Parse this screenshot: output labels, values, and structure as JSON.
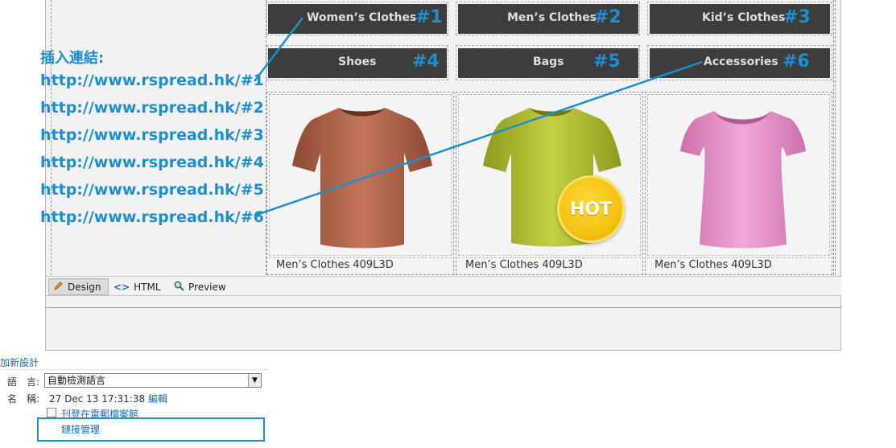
{
  "nav_buttons": [
    {
      "label": "Women’s Clothes",
      "tag": "#1"
    },
    {
      "label": "Men’s Clothes",
      "tag": "#2"
    },
    {
      "label": "Kid’s Clothes",
      "tag": "#3"
    },
    {
      "label": "Shoes",
      "tag": "#4"
    },
    {
      "label": "Bags",
      "tag": "#5"
    },
    {
      "label": "Accessories",
      "tag": "#6"
    }
  ],
  "products": [
    {
      "caption": "Men’s Clothes 409L3D",
      "shirt": "tshirt-brown-image",
      "color": "#b5694f"
    },
    {
      "caption": "Men’s Clothes 409L3D",
      "shirt": "tshirt-lime-image",
      "color": "#b8c33a"
    },
    {
      "caption": "Men’s Clothes 409L3D",
      "shirt": "tshirt-pink-image",
      "color": "#e392c7"
    }
  ],
  "hot_badge": "HOT",
  "annotation": {
    "title": "插入連結:",
    "links": [
      "http://www.rspread.hk/#1",
      "http://www.rspread.hk/#2",
      "http://www.rspread.hk/#3",
      "http://www.rspread.hk/#4",
      "http://www.rspread.hk/#5",
      "http://www.rspread.hk/#6"
    ],
    "color": "#1b8fd2"
  },
  "tabs": [
    {
      "label": "Design",
      "icon": "pencil-icon"
    },
    {
      "label": "HTML",
      "icon": "code-icon"
    },
    {
      "label": "Preview",
      "icon": "magnifier-icon"
    }
  ],
  "settings": {
    "section_link": "加新設計",
    "language_label": "語　言:",
    "language_value": "自動檢測語言",
    "name_label": "名　稱:",
    "name_value": "27 Dec 13 17:31:38",
    "edit_label": "編輯",
    "archive_label": "刊登在電郵檔案館",
    "link_manager": "鏈接管理"
  }
}
